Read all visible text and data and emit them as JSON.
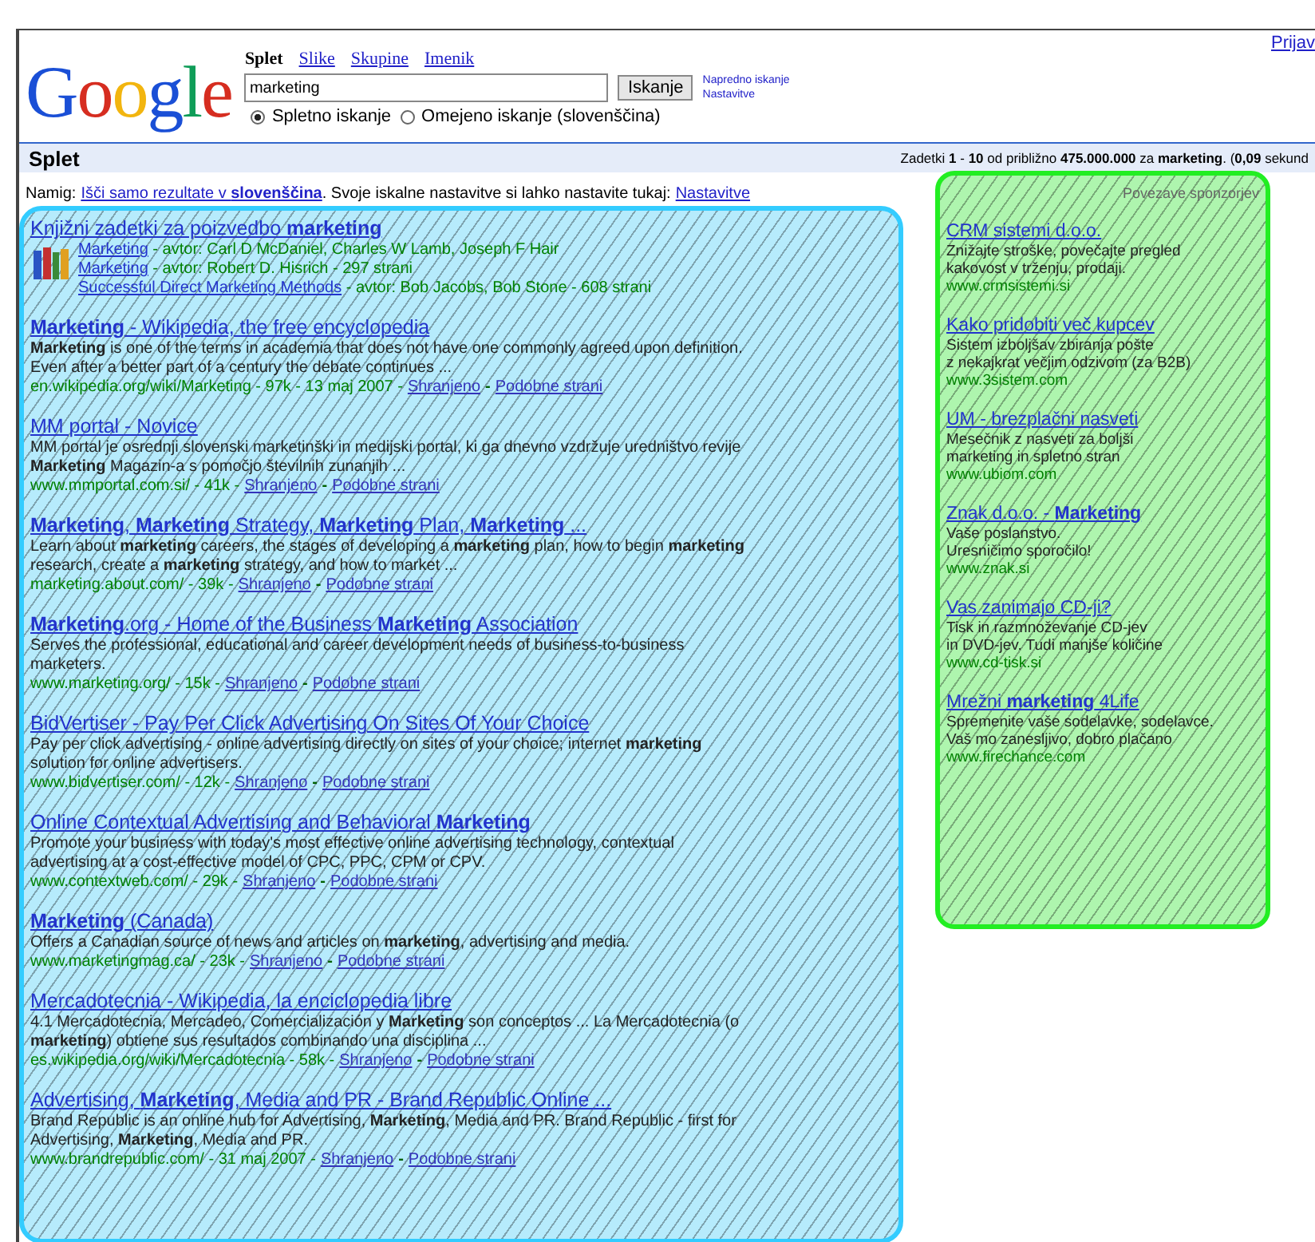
{
  "top_link": "Prijav",
  "logo": "Google",
  "tabs": [
    {
      "label": "Splet",
      "selected": true
    },
    {
      "label": "Slike",
      "selected": false
    },
    {
      "label": "Skupine",
      "selected": false
    },
    {
      "label": "Imenik",
      "selected": false
    }
  ],
  "search": {
    "value": "marketing",
    "button": "Iskanje",
    "links": [
      "Napredno iskanje",
      "Nastavitve"
    ]
  },
  "scope": [
    {
      "label": "Spletno iskanje",
      "selected": true
    },
    {
      "label": "Omejeno iskanje (slovenščina)",
      "selected": false
    }
  ],
  "bar": {
    "title": "Splet",
    "stats": "Zadetki **1** - **10** od približno **475.000.000** za **marketing**. (**0,09** sekund"
  },
  "hint": {
    "label": "Namig:",
    "link": "Išči samo rezultate v **slovenščina**",
    "text": ". Svoje iskalne nastavitve si lahko nastavite tukaj:",
    "settings": "Nastavitve"
  },
  "books": {
    "title": "Knjižni zadetki za poizvedbo **marketing**",
    "items": [
      {
        "title": "Marketing",
        "meta": " - avtor: Carl D McDaniel, Charles W Lamb, Joseph F Hair"
      },
      {
        "title": "Marketing",
        "meta": " - avtor: Robert D. Hisrich - 297 strani"
      },
      {
        "title": "Successful Direct Marketing Methods",
        "meta": " - avtor: Bob Jacobs, Bob Stone - 608 strani"
      }
    ]
  },
  "results": [
    {
      "title": "**Marketing** - Wikipedia, the free encyclopedia",
      "snippet": "**Marketing** is one of the terms in academia that does not have one commonly agreed upon definition. Even after a better part of a century the debate continues ...",
      "url": "en.wikipedia.org/wiki/Marketing - 97k - 13 maj 2007 -",
      "cache": "Shranjeno",
      "separator": "-",
      "similar": "Podobne strani"
    },
    {
      "title": "MM portal - Novice",
      "snippet": "MM portal je osrednji slovenski marketinški in medijski portal, ki ga dnevno vzdržuje uredništvo revije **Marketing** Magazin-a s pomočjo številnih zunanjih ...",
      "url": "www.mmportal.com.si/ - 41k -",
      "cache": "Shranjeno",
      "separator": "-",
      "similar": "Podobne strani"
    },
    {
      "title": "**Marketing**, **Marketing** Strategy, **Marketing** Plan, **Marketing** ...",
      "snippet": "Learn about **marketing** careers, the stages of developing a **marketing** plan, how to begin **marketing** research, create a **marketing** strategy, and how to market ...",
      "url": "marketing.about.com/ - 39k -",
      "cache": "Shranjeno",
      "separator": "-",
      "similar": "Podobne strani"
    },
    {
      "title": "**Marketing**.org - Home of the Business **Marketing** Association",
      "snippet": "Serves the professional, educational and career development needs of business-to-business marketers.",
      "url": "www.marketing.org/ - 15k -",
      "cache": "Shranjeno",
      "separator": "-",
      "similar": "Podobne strani"
    },
    {
      "title": "BidVertiser - Pay Per Click Advertising On Sites Of Your Choice",
      "snippet": "Pay per click advertising - online advertising directly on sites of your choice; internet **marketing** solution for online advertisers.",
      "url": "www.bidvertiser.com/ - 12k -",
      "cache": "Shranjeno",
      "separator": "-",
      "similar": "Podobne strani"
    },
    {
      "title": "Online Contextual Advertising and Behavioral **Marketing**",
      "snippet": "Promote your business with today's most effective online advertising technology, contextual advertising at a cost-effective model of CPC, PPC, CPM or CPV.",
      "url": "www.contextweb.com/ - 29k -",
      "cache": "Shranjeno",
      "separator": "-",
      "similar": "Podobne strani"
    },
    {
      "title": "**Marketing** (Canada)",
      "snippet": "Offers a Canadian source of news and articles on **marketing**, advertising and media.",
      "url": "www.marketingmag.ca/ - 23k -",
      "cache": "Shranjeno",
      "separator": "-",
      "similar": "Podobne strani"
    },
    {
      "title": "Mercadotecnia - Wikipedia, la enciclopedia libre",
      "snippet": "4.1 Mercadotecnia, Mercadeo, Comercialización y **Marketing** son conceptos ... La Mercadotecnia (o **marketing**) obtiene sus resultados combinando una disciplina ...",
      "url": "es.wikipedia.org/wiki/Mercadotecnia - 58k -",
      "cache": "Shranjeno",
      "separator": "-",
      "similar": "Podobne strani"
    },
    {
      "title": "Advertising, **Marketing**, Media and PR - Brand Republic Online ...",
      "snippet": "Brand Republic is an online hub for Advertising, **Marketing**, Media and PR. Brand Republic - first for Advertising, **Marketing**, Media and PR.",
      "url": "www.brandrepublic.com/ - 31 maj 2007 -",
      "cache": "Shranjeno",
      "separator": "-",
      "similar": "Podobne strani"
    }
  ],
  "ads": {
    "heading": "Povezave sponzorjev",
    "items": [
      {
        "title": "CRM sistemi d.o.o.",
        "lines": [
          "Znižajte stroške, povečajte pregled",
          "kakovost v trženju, prodaji."
        ],
        "url": "www.crmsistemi.si"
      },
      {
        "title": "Kako pridobiti več kupcev",
        "lines": [
          "Sistem izboljšav zbiranja pošte",
          "z nekajkrat večjim odzivom (za B2B)"
        ],
        "url": "www.3sistem.com"
      },
      {
        "title": "UM - brezplačni nasveti",
        "lines": [
          "Mesečnik z nasveti za boljši",
          "marketing in spletno stran"
        ],
        "url": "www.ubiom.com"
      },
      {
        "title": "Znak d.o.o. - **Marketing**",
        "lines": [
          "Vaše poslanstvo.",
          "Uresničimo sporočilo!"
        ],
        "url": "www.znak.si"
      },
      {
        "title": "Vas zanimajo CD-ji?",
        "lines": [
          "Tisk in razmnoževanje CD-jev",
          "in DVD-jev. Tudi manjše količine"
        ],
        "url": "www.cd-tisk.si"
      },
      {
        "title": "Mrežni **marketing** 4Life",
        "lines": [
          "Spremenite vaše sodelavke, sodelavce.",
          "Vaš mo zanesljivo, dobro plačano"
        ],
        "url": "www.firechance.com"
      }
    ]
  }
}
